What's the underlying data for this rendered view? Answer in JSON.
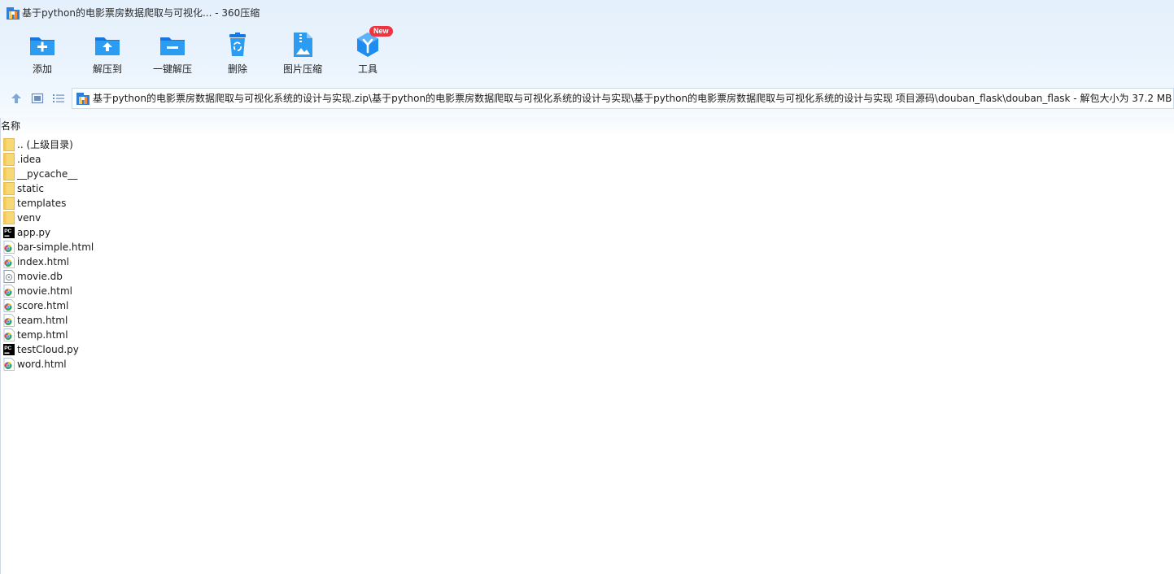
{
  "window": {
    "title": "基于python的电影票房数据爬取与可视化... - 360压缩"
  },
  "toolbar": {
    "buttons": [
      {
        "label": "添加",
        "icon": "add-folder-icon"
      },
      {
        "label": "解压到",
        "icon": "extract-to-icon"
      },
      {
        "label": "一键解压",
        "icon": "one-click-extract-icon"
      },
      {
        "label": "删除",
        "icon": "delete-trash-icon"
      },
      {
        "label": "图片压缩",
        "icon": "image-compress-icon"
      },
      {
        "label": "工具",
        "icon": "tools-cube-icon"
      }
    ],
    "new_badge": "New"
  },
  "nav": {
    "icons": [
      "up-arrow-icon",
      "thumbnail-view-icon",
      "list-view-icon"
    ],
    "address": "基于python的电影票房数据爬取与可视化系统的设计与实现.zip\\基于python的电影票房数据爬取与可视化系统的设计与实现\\基于python的电影票房数据爬取与可视化系统的设计与实现 项目源码\\douban_flask\\douban_flask - 解包大小为 37.2 MB"
  },
  "list": {
    "column_name": "名称",
    "items": [
      {
        "name": ".. (上级目录)",
        "type": "folder"
      },
      {
        "name": ".idea",
        "type": "folder"
      },
      {
        "name": "__pycache__",
        "type": "folder"
      },
      {
        "name": "static",
        "type": "folder"
      },
      {
        "name": "templates",
        "type": "folder"
      },
      {
        "name": "venv",
        "type": "folder"
      },
      {
        "name": "app.py",
        "type": "pycharm"
      },
      {
        "name": "bar-simple.html",
        "type": "html"
      },
      {
        "name": "index.html",
        "type": "html"
      },
      {
        "name": "movie.db",
        "type": "db"
      },
      {
        "name": "movie.html",
        "type": "html"
      },
      {
        "name": "score.html",
        "type": "html"
      },
      {
        "name": "team.html",
        "type": "html"
      },
      {
        "name": "temp.html",
        "type": "html"
      },
      {
        "name": "testCloud.py",
        "type": "pycharm"
      },
      {
        "name": "word.html",
        "type": "html"
      }
    ]
  },
  "colors": {
    "accent_blue": "#1e90ee",
    "chrome_bg": "#e6f1fc",
    "badge_red": "#ef3340",
    "folder_yellow": "#f8d775"
  }
}
